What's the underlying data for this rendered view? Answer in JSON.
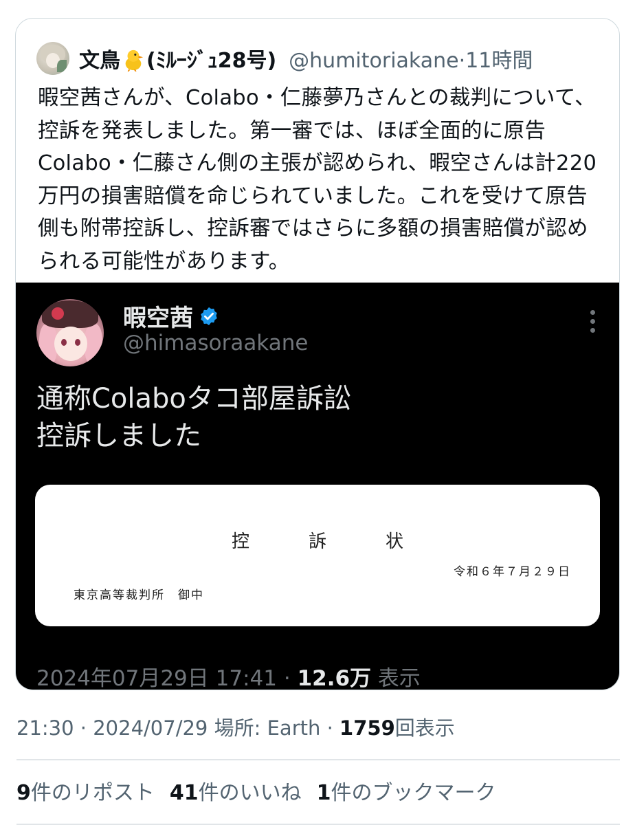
{
  "quote": {
    "author_name": "文鳥",
    "author_name_suffix": "(ﾐﾙｰｼﾞｭ28号)",
    "author_handle": "@humitoriakane",
    "separator": "·",
    "time_ago": "11時間",
    "text": "暇空茜さんが、Colabo・仁藤夢乃さんとの裁判について、控訴を発表しました。第一審では、ほぼ全面的に原告Colabo・仁藤さん側の主張が認められ、暇空さんは計220万円の損害賠償を命じられていました。これを受けて原告側も附帯控訴し、控訴審ではさらに多額の損害賠償が認められる可能性があります。"
  },
  "embedded_post": {
    "name": "暇空茜",
    "handle": "@himasoraakane",
    "text_line1": "通称Colaboタコ部屋訴訟",
    "text_line2": "控訴しました",
    "document": {
      "title": "控　訴　状",
      "date": "令和６年７月２９日",
      "court": "東京高等裁判所　御中"
    },
    "timestamp": "2024年07月29日 17:41",
    "separator": "·",
    "views_count": "12.6万",
    "views_label": "表示"
  },
  "post_meta": {
    "time": "21:30",
    "sep1": "·",
    "date": "2024/07/29",
    "location_label": "場所: Earth",
    "sep2": "·",
    "views_count": "1759",
    "views_label": "回表示"
  },
  "stats": {
    "reposts_count": "9",
    "reposts_label": "件のリポスト",
    "likes_count": "41",
    "likes_label": "件のいいね",
    "bookmarks_count": "1",
    "bookmarks_label": "件のブックマーク"
  },
  "icons": {
    "chick_emoji": "baby-chick-icon",
    "verified": "verified-badge-icon",
    "more": "more-vertical-icon"
  },
  "colors": {
    "verified_blue": "#1d9bf0",
    "muted_text": "#536471",
    "embed_bg": "#000000"
  }
}
